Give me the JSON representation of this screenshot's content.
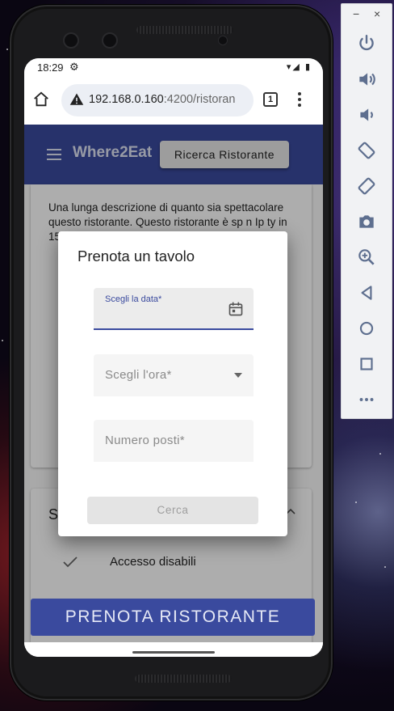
{
  "status_bar": {
    "time": "18:29",
    "signal": "▾◢ ▮"
  },
  "browser": {
    "url_host": "192.168.0.160",
    "url_rest": ":4200/ristoran",
    "tab_count": "1"
  },
  "app": {
    "title": "Where2Eat",
    "search_button": "Ricerca Ristorante"
  },
  "restaurant": {
    "description": "Una lunga descrizione di quanto sia spettacolare questo ristorante. Questo ristorante è sp                                                        n Ip ty in 15 ty bo al re po Le pa pu in",
    "section_header": "S",
    "features": [
      {
        "label": "Accesso disabili"
      }
    ],
    "book_button": "PRENOTA RISTORANTE"
  },
  "dialog": {
    "title": "Prenota un tavolo",
    "date_label": "Scegli la data*",
    "time_placeholder": "Scegli l'ora*",
    "seats_placeholder": "Numero posti*",
    "search_button": "Cerca"
  },
  "colors": {
    "primary": "#3a4a9e",
    "primary_text": "#dfe3f4"
  },
  "icons": {
    "statusbar": [
      "settings-icon",
      "wifi-icon",
      "signal-icon",
      "battery-icon"
    ],
    "emulator": [
      "power-icon",
      "volume-up-icon",
      "volume-down-icon",
      "rotate-left-icon",
      "rotate-right-icon",
      "camera-icon",
      "zoom-icon",
      "back-icon",
      "home-icon",
      "overview-icon",
      "more-icon"
    ]
  },
  "emulator": {
    "minimize": "−",
    "close": "×"
  }
}
